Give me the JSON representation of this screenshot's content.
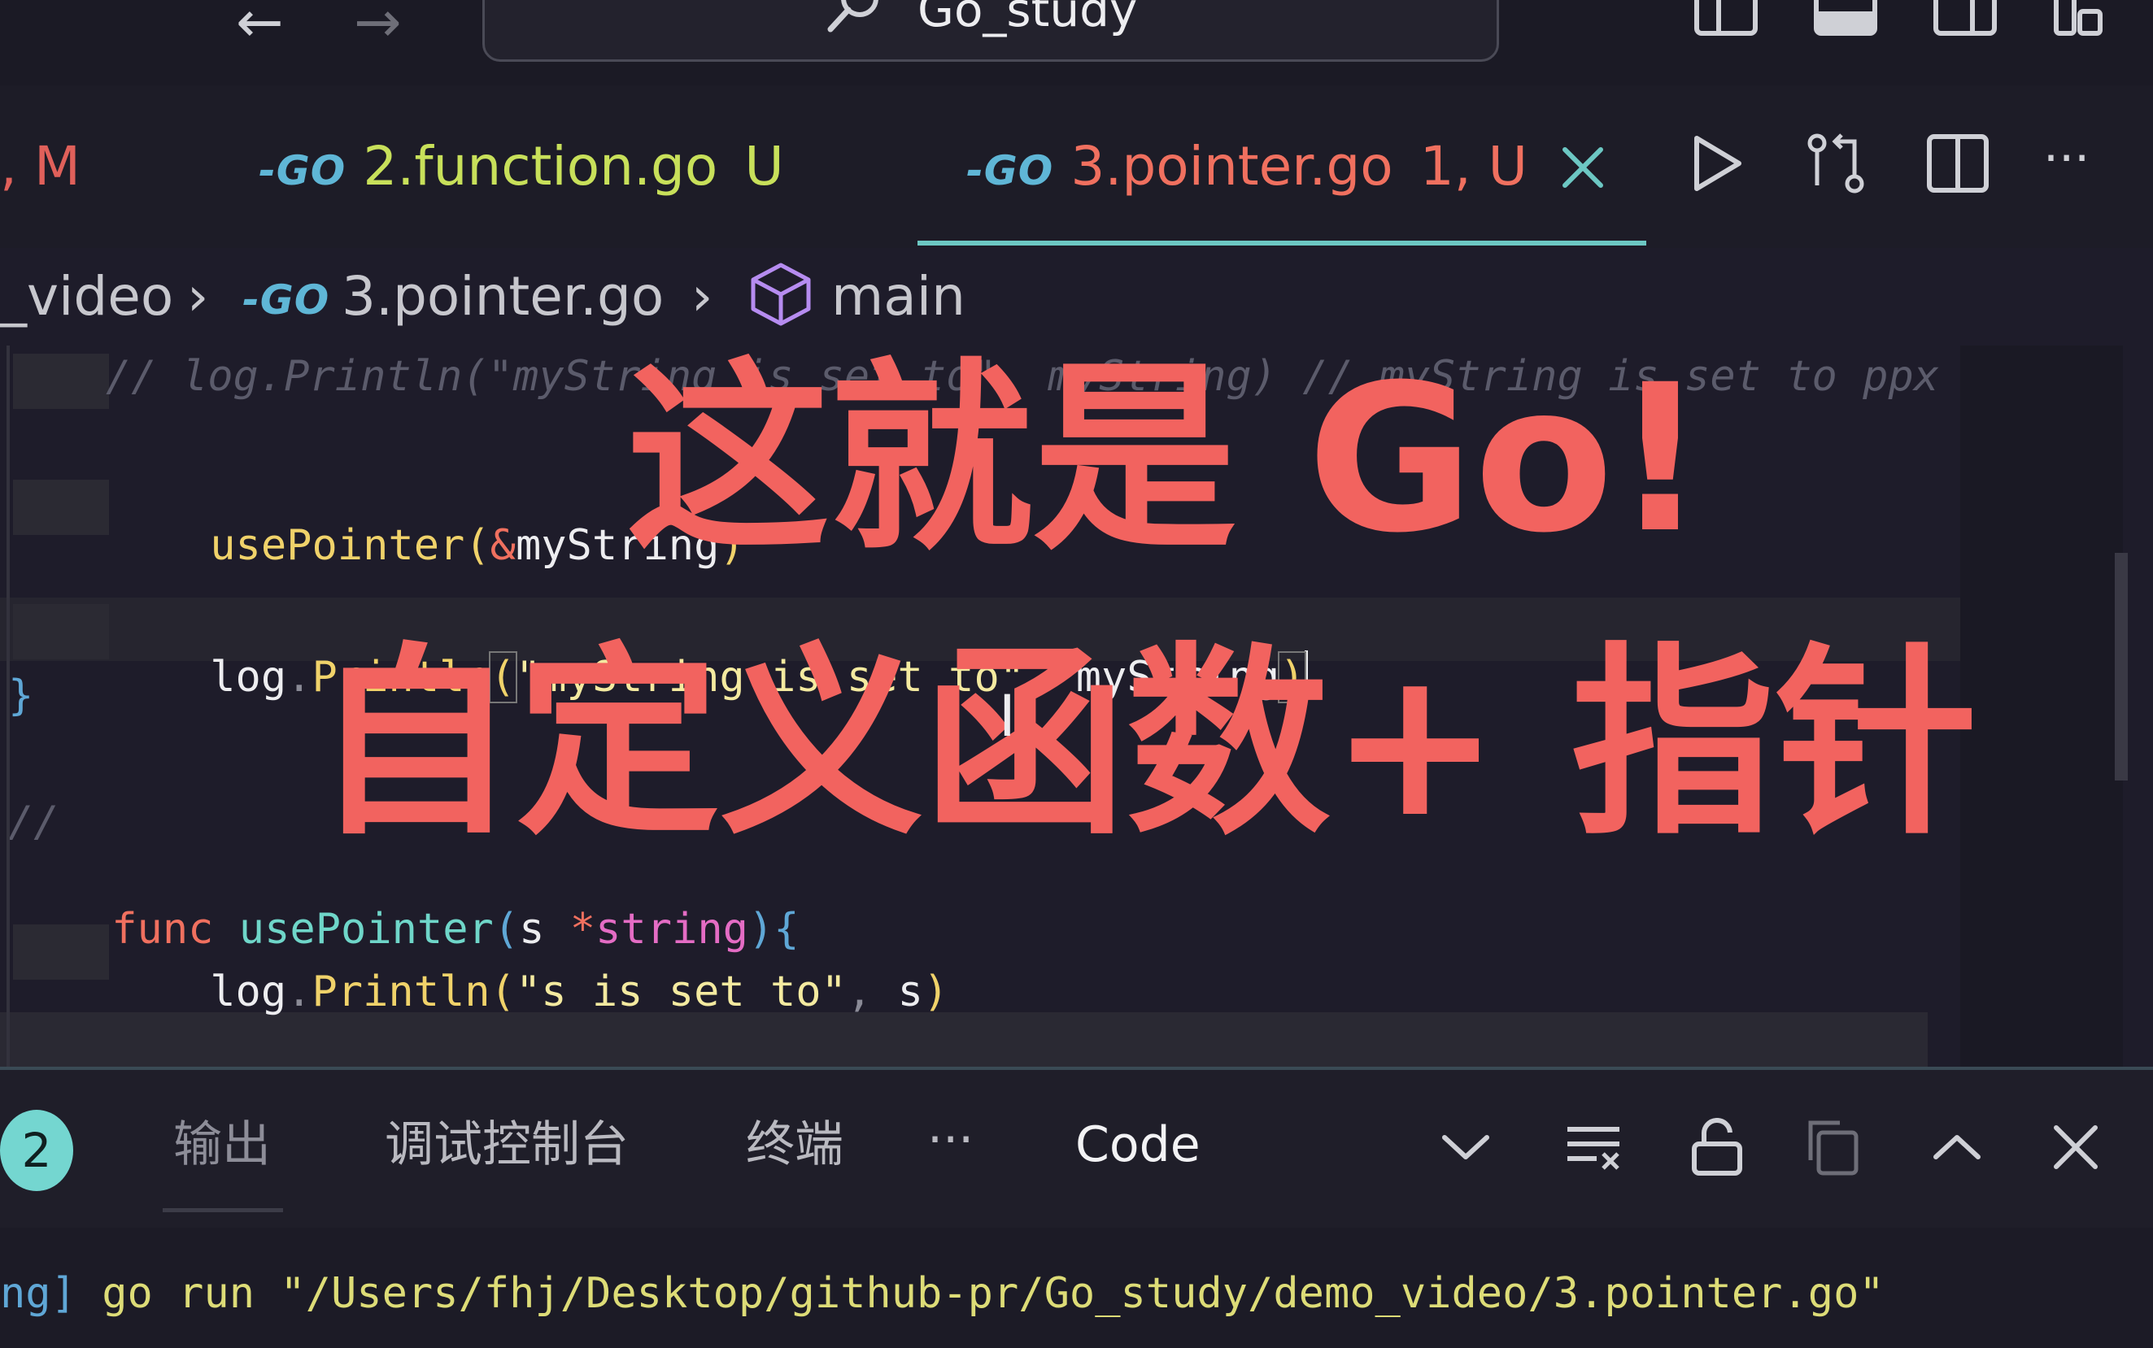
{
  "window": {
    "search_text": "Go_study"
  },
  "tabs": [
    {
      "label": "2.function.go",
      "status": "U",
      "go_logo": "-GO"
    },
    {
      "label": "3.pointer.go",
      "status": "1, U",
      "go_logo": "-GO"
    }
  ],
  "tab_left_fragment": ", M",
  "breadcrumb": {
    "folder": "_video",
    "file": "3.pointer.go",
    "symbol": "main"
  },
  "code": {
    "comment_line": "// log.Println(\"myString is set to\", myString) // myString is set to ppx",
    "line_usepointer_call": {
      "fn": "usePointer",
      "open": "(",
      "amp": "&",
      "arg": "myString",
      "close": ")"
    },
    "line_println": {
      "obj": "log",
      "dot": ".",
      "fn": "Println",
      "open": "(",
      "str": "\"myString is set to\"",
      "comma": ", ",
      "arg": "myString",
      "close": ")"
    },
    "closing_brace": "}",
    "empty_comment": "//",
    "func_decl": {
      "kw": "func",
      "name": "usePointer",
      "open": "(",
      "param": "s",
      "star": "*",
      "type": "string",
      "close": ")",
      "brace": "{"
    },
    "line_println_s": {
      "obj": "log",
      "dot": ".",
      "fn": "Println",
      "open": "(",
      "str": "\"s is set to\"",
      "comma": ", ",
      "arg": "s",
      "close": ")"
    }
  },
  "overlay": {
    "line1": "这就是 Go!",
    "line2": "自定义函数+ 指针"
  },
  "panel": {
    "badge": "2",
    "tabs": [
      "输出",
      "调试控制台",
      "终端"
    ],
    "more": "···",
    "dropdown_value": "Code"
  },
  "terminal": {
    "prefix": "ng]",
    "command": " go run \"/Users/fhj/Desktop/github-pr/Go_study/demo_video/3.pointer.go\""
  },
  "colors": {
    "accent_tab_underline": "#6cc7c3",
    "overlay_text": "#f2635f",
    "modified_tab": "#e0605a",
    "untracked": "#c8e05a"
  },
  "icons": [
    "back-arrow-icon",
    "forward-arrow-icon",
    "search-icon",
    "layout-sidebar-icon",
    "layout-panel-icon",
    "layout-split-icon",
    "layout-custom-icon",
    "go-file-icon",
    "close-icon",
    "run-icon",
    "compare-changes-icon",
    "split-editor-icon",
    "more-actions-icon",
    "symbol-cube-icon",
    "chevron-down-icon",
    "clear-output-icon",
    "lock-icon",
    "copy-icon",
    "chevron-up-icon",
    "close-panel-icon"
  ]
}
